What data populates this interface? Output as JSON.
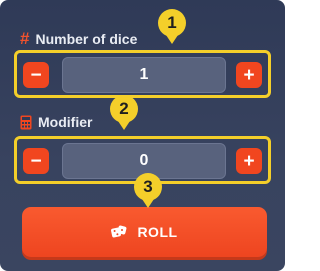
{
  "number_of_dice": {
    "label": "Number of dice",
    "icon": "hash-icon",
    "value": "1",
    "decrement_label": "−",
    "increment_label": "+"
  },
  "modifier": {
    "label": "Modifier",
    "icon": "calculator-icon",
    "value": "0",
    "decrement_label": "−",
    "increment_label": "+"
  },
  "roll": {
    "label": "ROLL",
    "icon": "dice-icon"
  },
  "callouts": [
    "1",
    "2",
    "3"
  ],
  "colors": {
    "panel_bg": "#2f3a57",
    "accent": "#f1461f",
    "callout": "#f4cf2a"
  }
}
